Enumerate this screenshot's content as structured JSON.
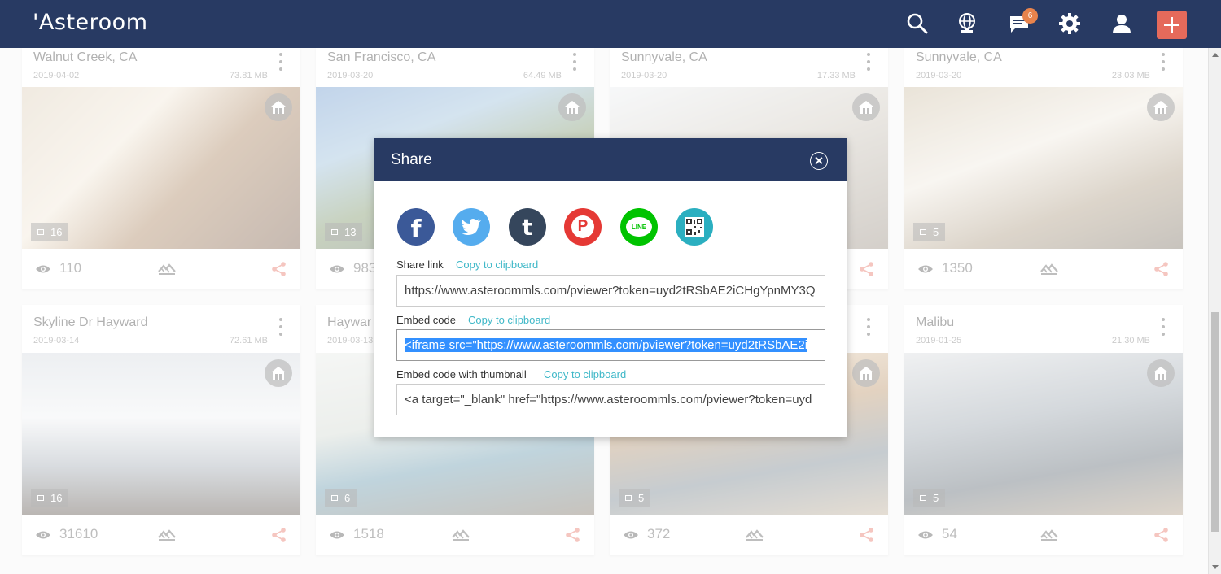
{
  "app": {
    "logo_text": "'Asteroom"
  },
  "topbar": {
    "icons": [
      "search-icon",
      "language-icon",
      "messages-icon",
      "settings-icon",
      "user-icon",
      "add-icon"
    ],
    "message_badge": "6"
  },
  "cards": [
    {
      "title": "Walnut Creek, CA",
      "date": "2019-04-02",
      "size": "73.81 MB",
      "photos": "16",
      "views": "110"
    },
    {
      "title": "San Francisco, CA",
      "date": "2019-03-20",
      "size": "64.49 MB",
      "photos": "13",
      "views": "983"
    },
    {
      "title": "Sunnyvale, CA",
      "date": "2019-03-20",
      "size": "17.33 MB",
      "photos": "",
      "views": ""
    },
    {
      "title": "Sunnyvale, CA",
      "date": "2019-03-20",
      "size": "23.03 MB",
      "photos": "5",
      "views": "1350"
    },
    {
      "title": "Skyline Dr Hayward",
      "date": "2019-03-14",
      "size": "72.61 MB",
      "photos": "16",
      "views": "31610"
    },
    {
      "title": "Haywar",
      "date": "2019-03-13",
      "size": "",
      "photos": "6",
      "views": "1518"
    },
    {
      "title": "",
      "date": "",
      "size": "",
      "photos": "5",
      "views": "372"
    },
    {
      "title": "Malibu",
      "date": "2019-01-25",
      "size": "21.30 MB",
      "photos": "5",
      "views": "54"
    }
  ],
  "modal": {
    "title": "Share",
    "social": [
      {
        "name": "facebook",
        "glyph": "f",
        "color": "#3b5998"
      },
      {
        "name": "twitter",
        "glyph": "",
        "color": "#55acee"
      },
      {
        "name": "tumblr",
        "glyph": "t",
        "color": "#35465c"
      },
      {
        "name": "plurk",
        "glyph": "P",
        "color": "#e53935"
      },
      {
        "name": "line",
        "glyph": "LINE",
        "color": "#00c300"
      },
      {
        "name": "qrcode",
        "glyph": "",
        "color": "#2bafc0"
      }
    ],
    "share_link": {
      "label": "Share link",
      "copy": "Copy to clipboard",
      "value": "https://www.asteroommls.com/pviewer?token=uyd2tRSbAE2iCHgYpnMY3Q"
    },
    "embed_code": {
      "label": "Embed code",
      "copy": "Copy to clipboard",
      "value": "<iframe src=\"https://www.asteroommls.com/pviewer?token=uyd2tRSbAE2i"
    },
    "embed_thumb": {
      "label": "Embed code with thumbnail",
      "copy": "Copy to clipboard",
      "value": "<a target=\"_blank\" href=\"https://www.asteroommls.com/pviewer?token=uyd"
    }
  }
}
